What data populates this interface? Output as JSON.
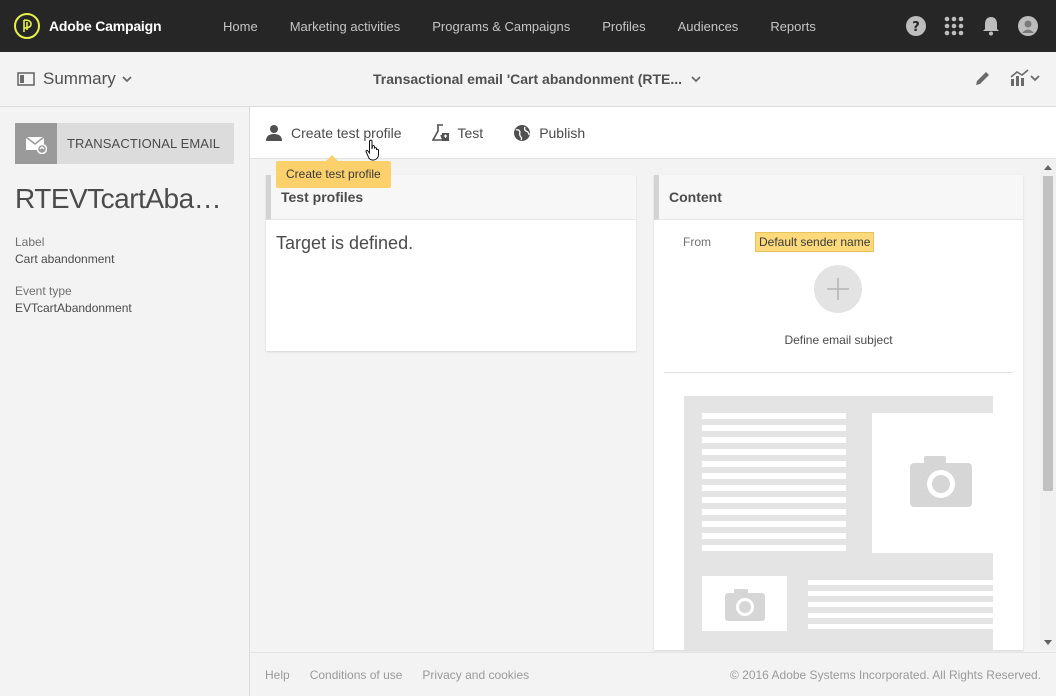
{
  "app": {
    "title": "Adobe Campaign"
  },
  "nav": {
    "items": [
      {
        "label": "Home"
      },
      {
        "label": "Marketing activities"
      },
      {
        "label": "Programs & Campaigns"
      },
      {
        "label": "Profiles"
      },
      {
        "label": "Audiences"
      },
      {
        "label": "Reports"
      }
    ],
    "icons": [
      "help-icon",
      "apps-grid-icon",
      "notifications-bell-icon",
      "user-avatar-icon"
    ]
  },
  "subheader": {
    "summary_label": "Summary",
    "document_title": "Transactional email 'Cart abandonment (RTE...",
    "icons": [
      "edit-pencil-icon",
      "reports-chart-icon"
    ]
  },
  "left_panel": {
    "type_label": "TRANSACTIONAL EMAIL",
    "delivery_name": "RTEVTcartAbandonment",
    "fields": [
      {
        "label": "Label",
        "value": "Cart abandonment"
      },
      {
        "label": "Event type",
        "value": "EVTcartAbandonment"
      }
    ]
  },
  "toolbar": {
    "create_test_profile": "Create test profile",
    "test": "Test",
    "publish": "Publish",
    "tooltip": "Create test profile"
  },
  "test_profiles": {
    "title": "Test profiles",
    "body": "Target is defined."
  },
  "content": {
    "title": "Content",
    "from_label": "From",
    "sender_name": "Default sender name",
    "subject_label": "Define email subject"
  },
  "footer": {
    "links": [
      "Help",
      "Conditions of use",
      "Privacy and cookies"
    ],
    "copyright": "© 2016 Adobe Systems Incorporated. All Rights Reserved."
  },
  "colors": {
    "topnav_bg": "#262626",
    "logo_accent": "#e6f04a",
    "tooltip_bg": "#fcd06b",
    "sender_chip_bg": "#fcd97a"
  }
}
